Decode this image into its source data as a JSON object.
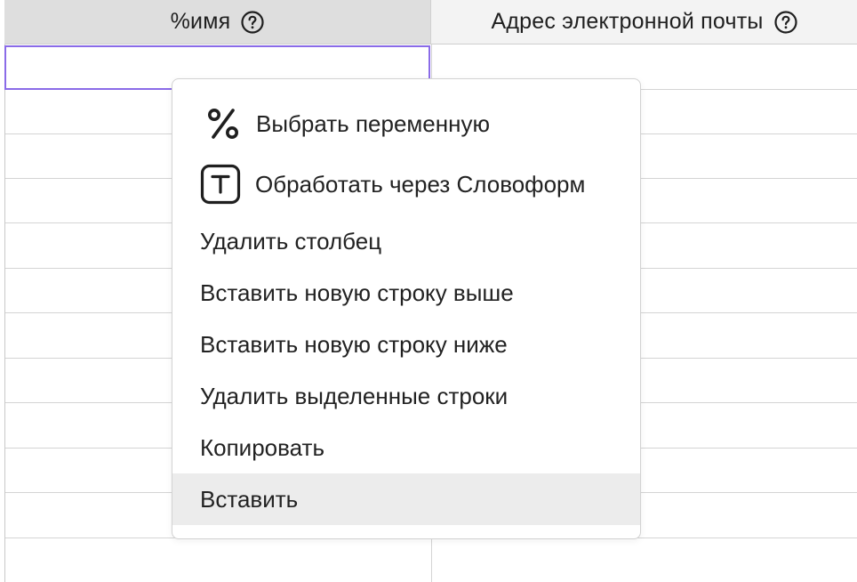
{
  "table": {
    "columns": [
      {
        "label": "%имя",
        "help_icon": "question-circle-icon"
      },
      {
        "label": "Адрес электронной почты",
        "help_icon": "question-circle-icon"
      }
    ],
    "selected_cell_color": "#8a6be8"
  },
  "context_menu": {
    "items": [
      {
        "label": "Выбрать переменную",
        "icon": "percent-icon"
      },
      {
        "label": "Обработать через Словоформ",
        "icon": "text-t-icon"
      },
      {
        "label": "Удалить столбец"
      },
      {
        "label": "Вставить новую строку выше"
      },
      {
        "label": "Вставить новую строку ниже"
      },
      {
        "label": "Удалить выделенные строки"
      },
      {
        "label": "Копировать"
      },
      {
        "label": "Вставить",
        "highlighted": true
      }
    ]
  }
}
